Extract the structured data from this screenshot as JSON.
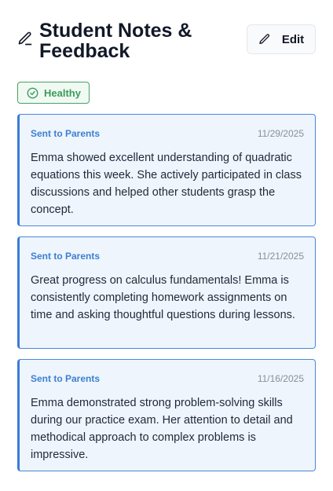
{
  "header": {
    "title": "Student Notes & Feedback",
    "edit_label": "Edit"
  },
  "status": {
    "label": "Healthy",
    "color": "#3c9a5a"
  },
  "colors": {
    "accent": "#3c7bd6",
    "card_bg": "#eef5fd"
  },
  "icons": {
    "title": "pencil-icon",
    "edit": "pencil-icon",
    "status": "check-circle-icon"
  },
  "notes": [
    {
      "tag": "Sent to Parents",
      "date": "11/29/2025",
      "text": "Emma showed excellent understanding of quadratic equations this week. She actively participated in class discussions and helped other students grasp the concept."
    },
    {
      "tag": "Sent to Parents",
      "date": "11/21/2025",
      "text": "Great progress on calculus fundamentals! Emma is consistently completing homework assignments on time and asking thoughtful questions during lessons."
    },
    {
      "tag": "Sent to Parents",
      "date": "11/16/2025",
      "text": "Emma demonstrated strong problem-solving skills during our practice exam. Her attention to detail and methodical approach to complex problems is impressive."
    }
  ]
}
